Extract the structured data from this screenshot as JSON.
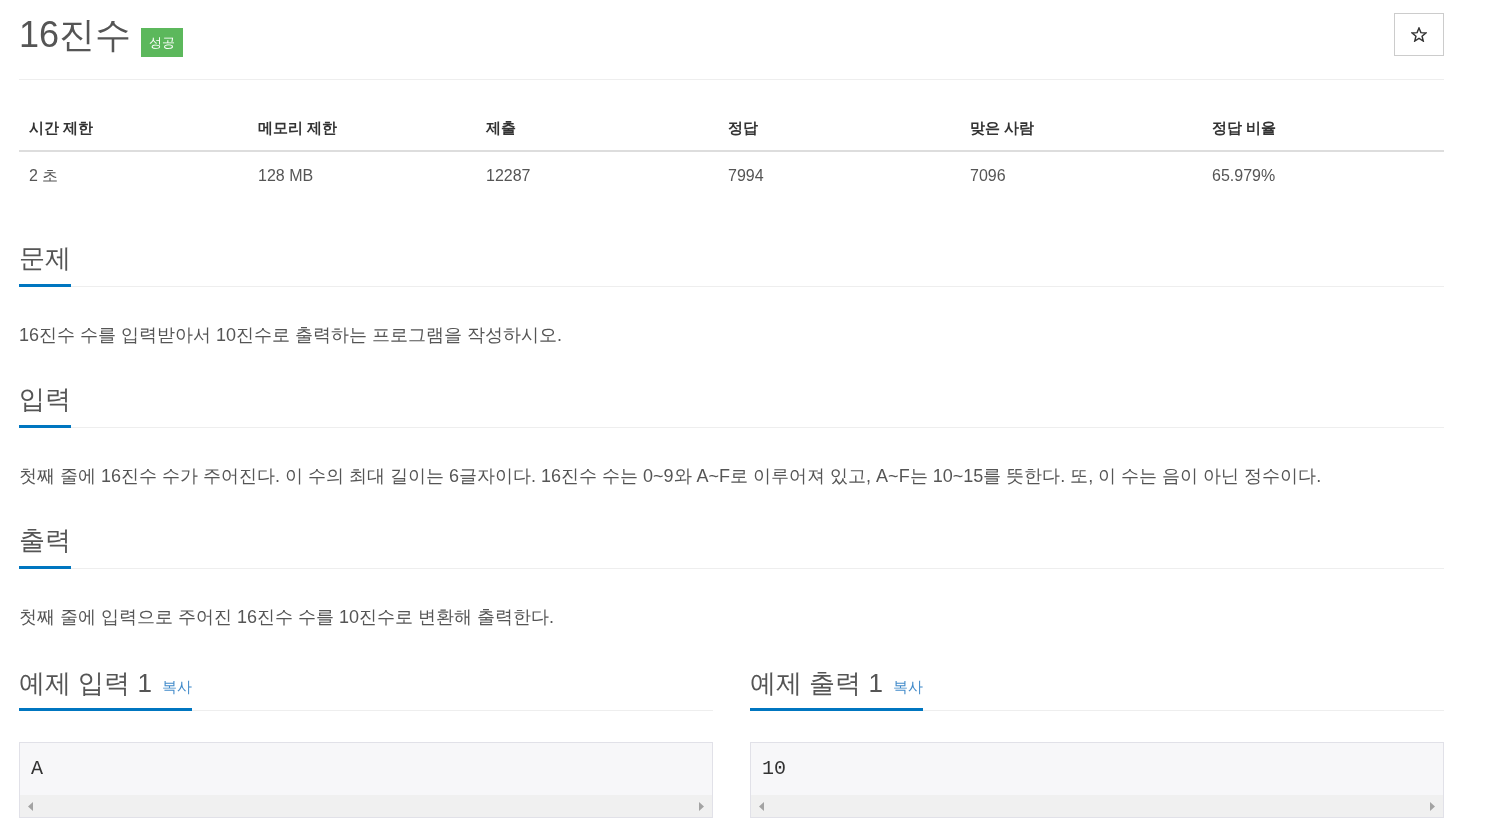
{
  "problem": {
    "title": "16진수",
    "status_badge": "성공"
  },
  "limits_table": {
    "columns": [
      "시간 제한",
      "메모리 제한",
      "제출",
      "정답",
      "맞은 사람",
      "정답 비율"
    ],
    "rows": [
      [
        "2 초",
        "128 MB",
        "12287",
        "7994",
        "7096",
        "65.979%"
      ]
    ]
  },
  "sections": [
    {
      "heading": "문제",
      "body": "16진수 수를 입력받아서 10진수로 출력하는 프로그램을 작성하시오."
    },
    {
      "heading": "입력",
      "body": "첫째 줄에 16진수 수가 주어진다. 이 수의 최대 길이는 6글자이다. 16진수 수는 0~9와 A~F로 이루어져 있고, A~F는 10~15를 뜻한다. 또, 이 수는 음이 아닌 정수이다."
    },
    {
      "heading": "출력",
      "body": "첫째 줄에 입력으로 주어진 16진수 수를 10진수로 변환해 출력한다."
    }
  ],
  "samples": [
    {
      "heading": "예제 입력 1",
      "copy_link": "복사",
      "content": "A"
    },
    {
      "heading": "예제 출력 1",
      "copy_link": "복사",
      "content": "10"
    }
  ]
}
